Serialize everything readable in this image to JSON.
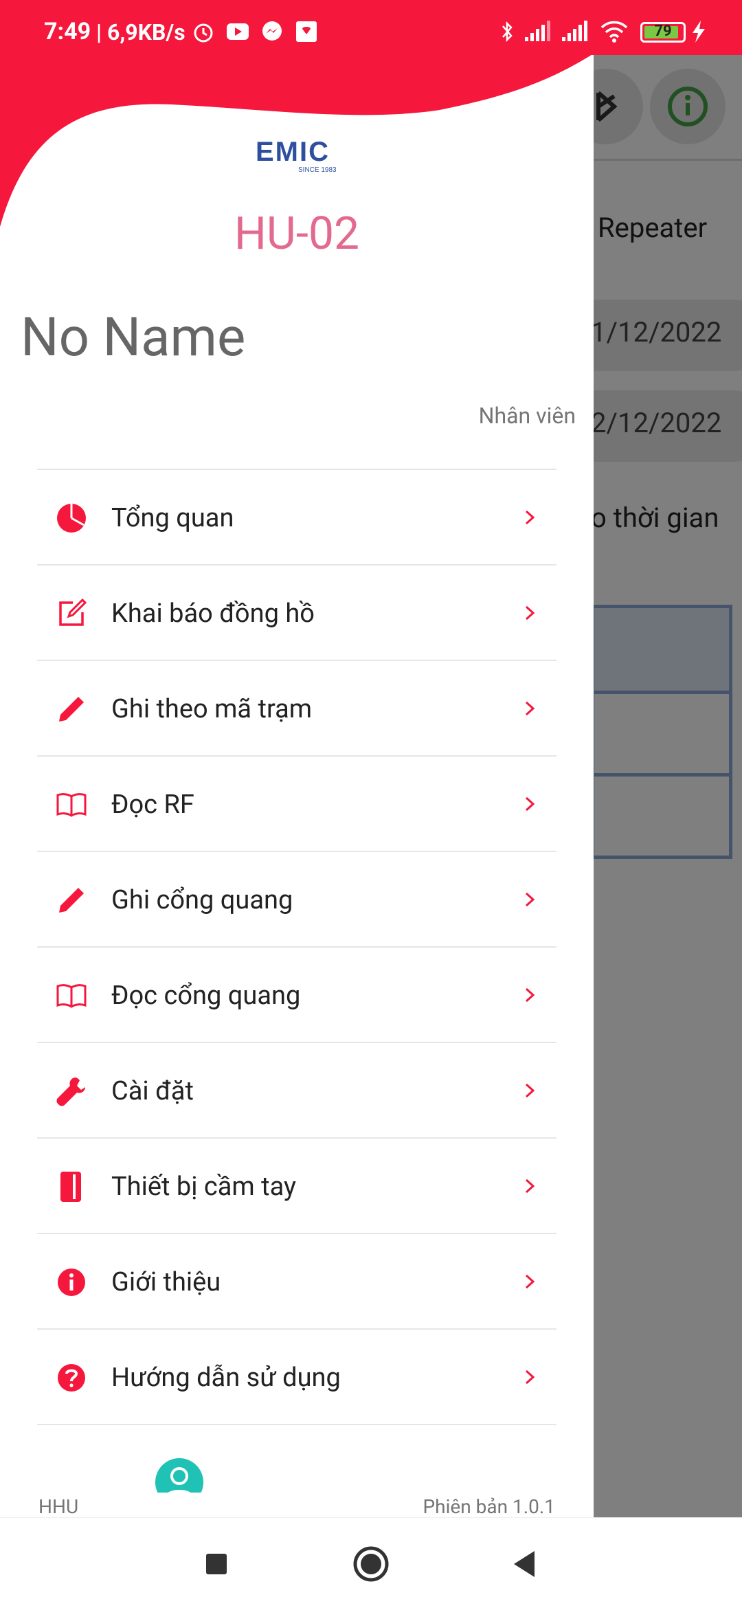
{
  "status_bar": {
    "time": "7:49",
    "net_speed": "| 6,9KB/s",
    "battery_level": "79",
    "icons": [
      "alarm-icon",
      "youtube-icon",
      "messenger-icon",
      "shopping-app-icon",
      "bluetooth-icon",
      "signal-icon",
      "signal-icon",
      "wifi-icon",
      "battery-icon",
      "charging-icon"
    ]
  },
  "colors": {
    "accent": "#f5173c",
    "device_text": "#e36a8e",
    "logo_blue": "#2f4f9e"
  },
  "background_screen": {
    "title": "Repeater",
    "date_from": "1/12/2022",
    "date_to": "2/12/2022",
    "label": "o thời gian"
  },
  "drawer": {
    "logo_text": "EMIC",
    "logo_tagline": "SINCE 1983",
    "device_id": "HU-02",
    "user_name": "No Name",
    "user_role": "Nhân viên",
    "menu": [
      {
        "label": "Tổng quan",
        "icon": "pie-chart-icon"
      },
      {
        "label": "Khai báo đồng hồ",
        "icon": "edit-square-icon"
      },
      {
        "label": "Ghi theo mã trạm",
        "icon": "pencil-icon"
      },
      {
        "label": "Đọc RF",
        "icon": "book-icon"
      },
      {
        "label": "Ghi cổng quang",
        "icon": "pencil-icon"
      },
      {
        "label": "Đọc cổng quang",
        "icon": "book-icon"
      },
      {
        "label": "Cài đặt",
        "icon": "wrench-icon"
      },
      {
        "label": "Thiết bị cầm tay",
        "icon": "handheld-device-icon"
      },
      {
        "label": "Giới thiệu",
        "icon": "info-icon"
      },
      {
        "label": "Hướng dẫn sử dụng",
        "icon": "help-icon"
      }
    ],
    "footer_brand": "HHU",
    "footer_version": "Phiên bản 1.0.1"
  }
}
